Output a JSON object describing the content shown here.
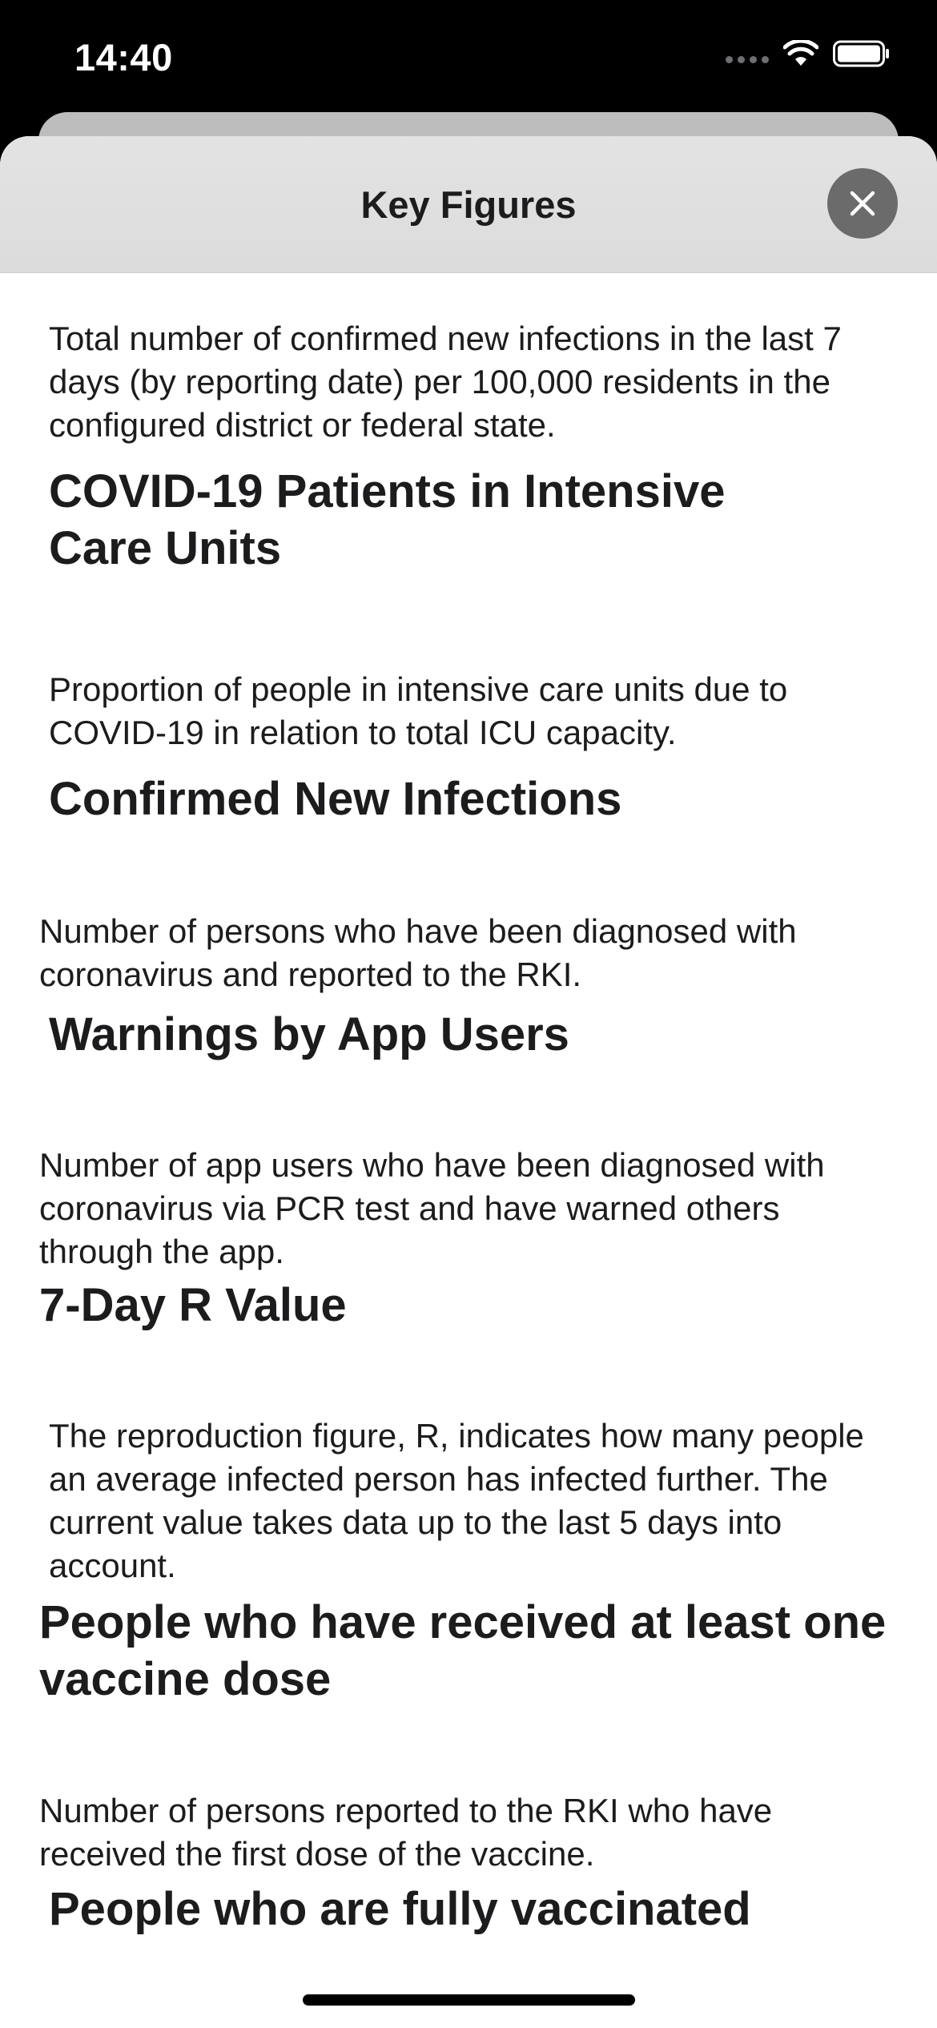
{
  "status_bar": {
    "time": "14:40",
    "icons": [
      "cellular-signal-icon",
      "wifi-icon",
      "battery-icon"
    ]
  },
  "sheet": {
    "title": "Key Figures",
    "close_icon": "close-icon"
  },
  "sections": [
    {
      "kind": "paragraph",
      "text": "Total number of confirmed new infections in the last 7 days (by reporting date) per 100,000 residents in the configured district or federal state."
    },
    {
      "kind": "heading",
      "text": "COVID-19 Patients in Intensive Care Units"
    },
    {
      "kind": "paragraph",
      "text": "Proportion of people in intensive care units due to COVID-19 in relation to total ICU capacity."
    },
    {
      "kind": "heading",
      "text": "Confirmed New Infections"
    },
    {
      "kind": "paragraph",
      "text": "Number of persons who have been diagnosed with coronavirus and reported to the RKI."
    },
    {
      "kind": "heading",
      "text": "Warnings by App Users"
    },
    {
      "kind": "paragraph",
      "text": "Number of app users who have been diagnosed with coronavirus via PCR test and have warned others through the app."
    },
    {
      "kind": "heading",
      "text": "7-Day R Value"
    },
    {
      "kind": "paragraph",
      "text": "The reproduction figure, R, indicates how many people an average infected person has infected further. The current value takes data up to the last 5 days into account."
    },
    {
      "kind": "heading",
      "text": "People who have received at least one vaccine dose"
    },
    {
      "kind": "paragraph",
      "text": "Number of persons reported to the RKI who have received the first dose of the vaccine."
    },
    {
      "kind": "heading",
      "text": "People who are fully vaccinated"
    }
  ]
}
